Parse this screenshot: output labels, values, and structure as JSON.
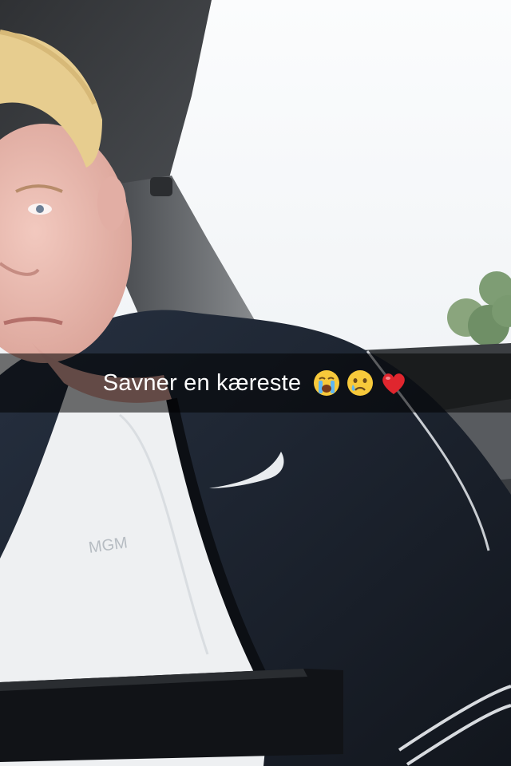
{
  "caption": {
    "text": "Savner en kæreste",
    "emojis": [
      "loudly-crying-face-icon",
      "crying-face-icon",
      "red-heart-icon"
    ]
  },
  "colors": {
    "window_sky": "#f2f4f6",
    "jacket": "#1c2430",
    "shirt": "#eef0f2",
    "car_interior": "#3e4144",
    "caption_bg": "rgba(0,0,0,0.55)"
  }
}
